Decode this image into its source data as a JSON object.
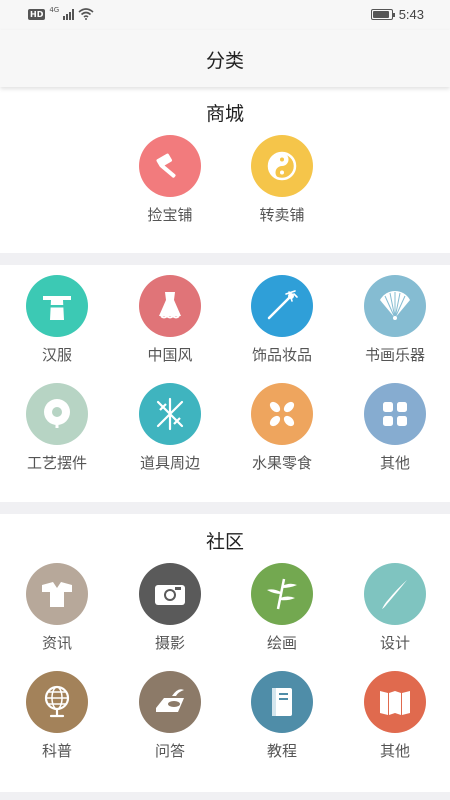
{
  "status_bar": {
    "hd_badge": "HD",
    "network": "4G",
    "time": "5:43",
    "battery_level": 0.9
  },
  "nav": {
    "title": "分类"
  },
  "mall": {
    "title": "商城",
    "items": [
      {
        "label": "捡宝铺",
        "color": "#f27b7d",
        "icon": "hammer-icon"
      },
      {
        "label": "转卖铺",
        "color": "#f5c54a",
        "icon": "yin-yang-icon"
      }
    ]
  },
  "categories": {
    "items": [
      {
        "label": "汉服",
        "color": "#3cc9b4",
        "icon": "hanfu-robe-icon"
      },
      {
        "label": "中国风",
        "color": "#e07478",
        "icon": "dress-icon"
      },
      {
        "label": "饰品妆品",
        "color": "#2f9fd8",
        "icon": "hairpin-icon"
      },
      {
        "label": "书画乐器",
        "color": "#85bcd2",
        "icon": "folding-fan-icon"
      },
      {
        "label": "工艺摆件",
        "color": "#b7d4c4",
        "icon": "jade-disc-icon"
      },
      {
        "label": "道具周边",
        "color": "#3fb4bf",
        "icon": "crossed-swords-icon"
      },
      {
        "label": "水果零食",
        "color": "#eea55e",
        "icon": "fruit-petals-icon"
      },
      {
        "label": "其他",
        "color": "#86acd0",
        "icon": "grid-icon"
      }
    ]
  },
  "community": {
    "title": "社区",
    "items": [
      {
        "label": "资讯",
        "color": "#b7a89a",
        "icon": "robe-news-icon"
      },
      {
        "label": "摄影",
        "color": "#5a5a5a",
        "icon": "camera-icon"
      },
      {
        "label": "绘画",
        "color": "#73a850",
        "icon": "bamboo-icon"
      },
      {
        "label": "设计",
        "color": "#7fc4c0",
        "icon": "brush-icon"
      },
      {
        "label": "科普",
        "color": "#a3825a",
        "icon": "globe-icon"
      },
      {
        "label": "问答",
        "color": "#8c7a68",
        "icon": "inkstone-icon"
      },
      {
        "label": "教程",
        "color": "#4f8da8",
        "icon": "book-icon"
      },
      {
        "label": "其他",
        "color": "#e06a4e",
        "icon": "screen-icon"
      }
    ]
  }
}
